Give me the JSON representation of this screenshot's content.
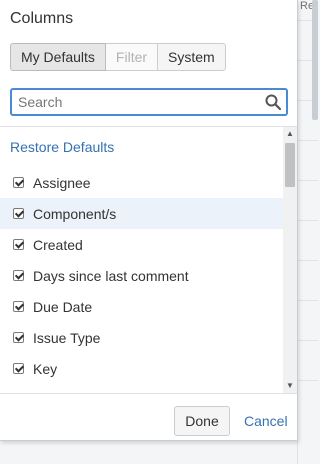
{
  "background": {
    "header_fragment": "Re"
  },
  "dialog": {
    "title": "Columns",
    "tabs": [
      {
        "label": "My Defaults",
        "state": "active"
      },
      {
        "label": "Filter",
        "state": "disabled"
      },
      {
        "label": "System",
        "state": "normal"
      }
    ],
    "search": {
      "placeholder": "Search",
      "value": ""
    },
    "restore_label": "Restore Defaults",
    "items": [
      {
        "label": "Assignee",
        "checked": true
      },
      {
        "label": "Component/s",
        "checked": true
      },
      {
        "label": "Created",
        "checked": true
      },
      {
        "label": "Days since last comment",
        "checked": true
      },
      {
        "label": "Due Date",
        "checked": true
      },
      {
        "label": "Issue Type",
        "checked": true
      },
      {
        "label": "Key",
        "checked": true
      }
    ],
    "footer": {
      "done_label": "Done",
      "cancel_label": "Cancel"
    }
  },
  "colors": {
    "link": "#3572b0",
    "focus_border": "#4a8ad4",
    "hover_row": "#ebf2f9"
  }
}
